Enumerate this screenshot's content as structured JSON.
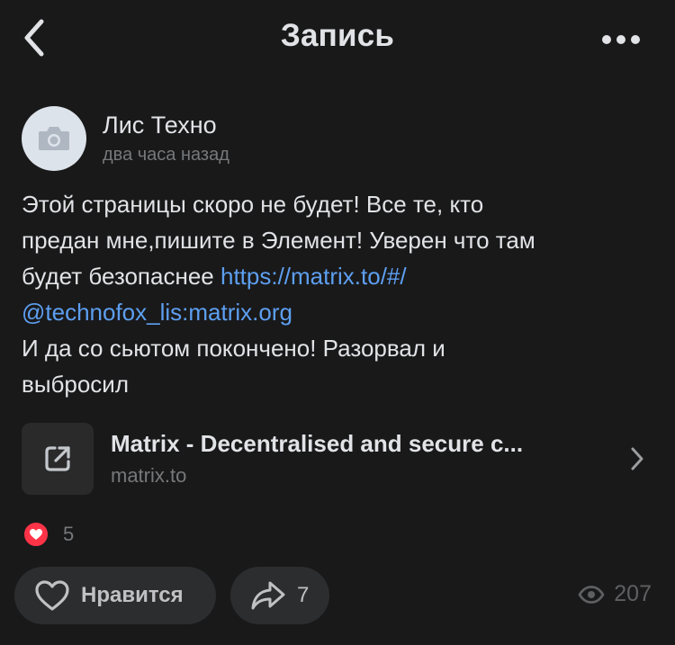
{
  "header": {
    "title": "Запись",
    "back_icon": "chevron-left-icon",
    "more_icon": "more-horizontal-icon"
  },
  "author": {
    "name": "Лис Техно",
    "time": "два часа назад",
    "avatar_icon": "camera-icon"
  },
  "post": {
    "line1": "Этой страницы скоро не будет! Все те, кто",
    "line2": "предан мне,пишите в Элемент! Уверен что там",
    "line3_text": "будет безопаснее ",
    "line3_link": "https://matrix.to/#/",
    "line4_link": "@technofox_lis:matrix.org",
    "line5": "И да со сьютом покончено! Разорвал и",
    "line6": "выбросил"
  },
  "link_card": {
    "title": "Matrix - Decentralised and secure c...",
    "domain": "matrix.to",
    "icon": "external-link-icon"
  },
  "reactions": {
    "count": "5",
    "icon": "heart-icon",
    "color": "#ff3347"
  },
  "actions": {
    "like_label": "Нравится",
    "share_count": "7",
    "views_count": "207"
  },
  "colors": {
    "background": "#19191a",
    "link": "#5d9ff0",
    "pill": "#2c2d2e",
    "secondary_text": "#76787a"
  }
}
